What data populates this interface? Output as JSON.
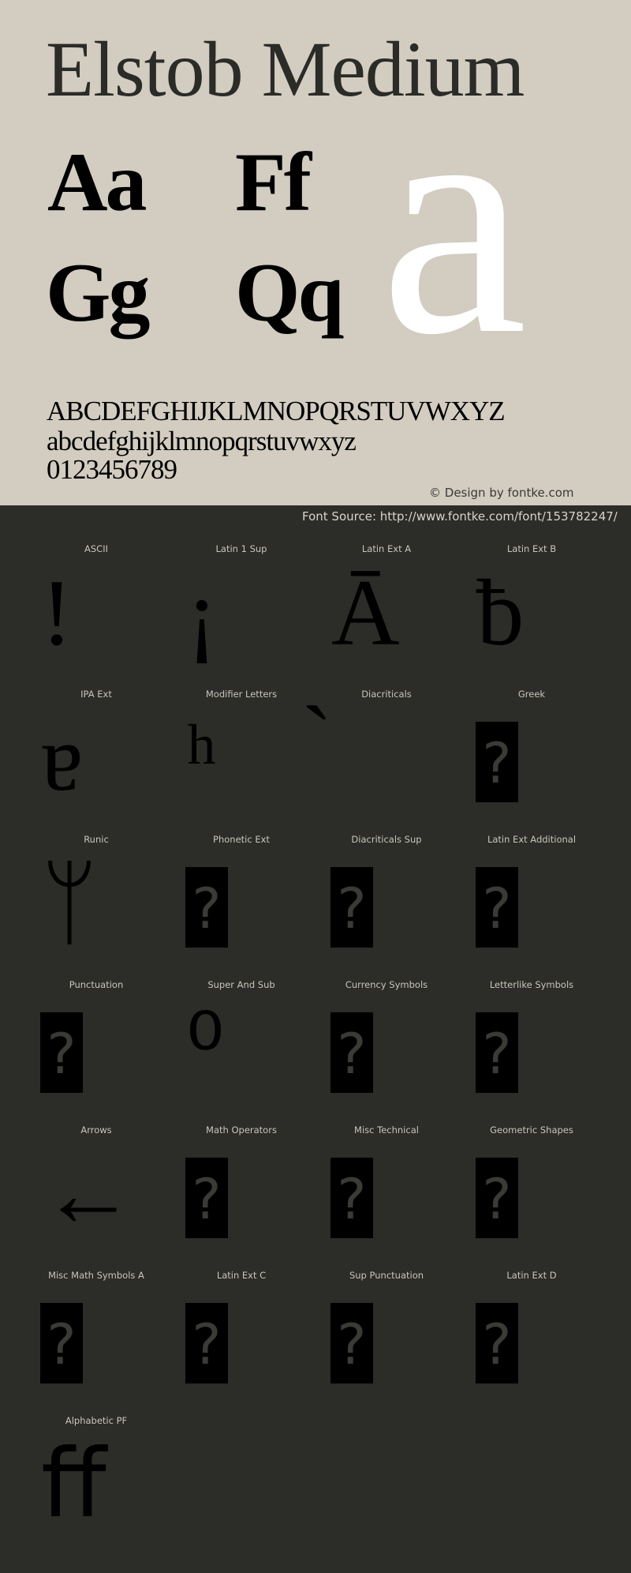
{
  "hero": {
    "title": "Elstob Medium",
    "pairs": [
      "Aa",
      "Ff",
      "Gg",
      "Qq"
    ],
    "big_glyph": "a",
    "uppercase": "ABCDEFGHIJKLMNOPQRSTUVWXYZ",
    "lowercase": "abcdefghijklmnopqrstuvwxyz",
    "digits": "0123456789",
    "credit": "© Design by fontke.com",
    "colors": {
      "background": "#d2ccc1",
      "text": "#000000",
      "big_glyph": "#ffffff"
    }
  },
  "source": {
    "text": "Font Source: http://www.fontke.com/font/153782247/"
  },
  "grid": {
    "colors": {
      "background": "#2c2c28",
      "label": "#c9c5bc",
      "glyph": "#000000"
    },
    "missing_glyph_icon": "?",
    "cells": [
      {
        "label": "ASCII",
        "glyph": "!",
        "missing": false
      },
      {
        "label": "Latin 1 Sup",
        "glyph": "¡",
        "missing": false
      },
      {
        "label": "Latin Ext A",
        "glyph": "Ā",
        "missing": false
      },
      {
        "label": "Latin Ext B",
        "glyph": "ƀ",
        "missing": false
      },
      {
        "label": "IPA Ext",
        "glyph": "ɐ",
        "missing": false
      },
      {
        "label": "Modifier Letters",
        "glyph": "ʰ",
        "missing": false
      },
      {
        "label": "Diacriticals",
        "glyph": "̀",
        "missing": false
      },
      {
        "label": "Greek",
        "glyph": "",
        "missing": true
      },
      {
        "label": "Runic",
        "glyph": "ᛘ",
        "missing": false
      },
      {
        "label": "Phonetic Ext",
        "glyph": "",
        "missing": true
      },
      {
        "label": "Diacriticals Sup",
        "glyph": "",
        "missing": true
      },
      {
        "label": "Latin Ext Additional",
        "glyph": "",
        "missing": true
      },
      {
        "label": "Punctuation",
        "glyph": "",
        "missing": true
      },
      {
        "label": "Super And Sub",
        "glyph": "⁰",
        "missing": false
      },
      {
        "label": "Currency Symbols",
        "glyph": "",
        "missing": true
      },
      {
        "label": "Letterlike Symbols",
        "glyph": "",
        "missing": true
      },
      {
        "label": "Arrows",
        "glyph": "←",
        "missing": false
      },
      {
        "label": "Math Operators",
        "glyph": "",
        "missing": true
      },
      {
        "label": "Misc Technical",
        "glyph": "",
        "missing": true
      },
      {
        "label": "Geometric Shapes",
        "glyph": "",
        "missing": true
      },
      {
        "label": "Misc Math Symbols A",
        "glyph": "",
        "missing": true
      },
      {
        "label": "Latin Ext C",
        "glyph": "",
        "missing": true
      },
      {
        "label": "Sup Punctuation",
        "glyph": "",
        "missing": true
      },
      {
        "label": "Latin Ext D",
        "glyph": "",
        "missing": true
      },
      {
        "label": "Alphabetic PF",
        "glyph": "ﬀ",
        "missing": false
      }
    ]
  }
}
